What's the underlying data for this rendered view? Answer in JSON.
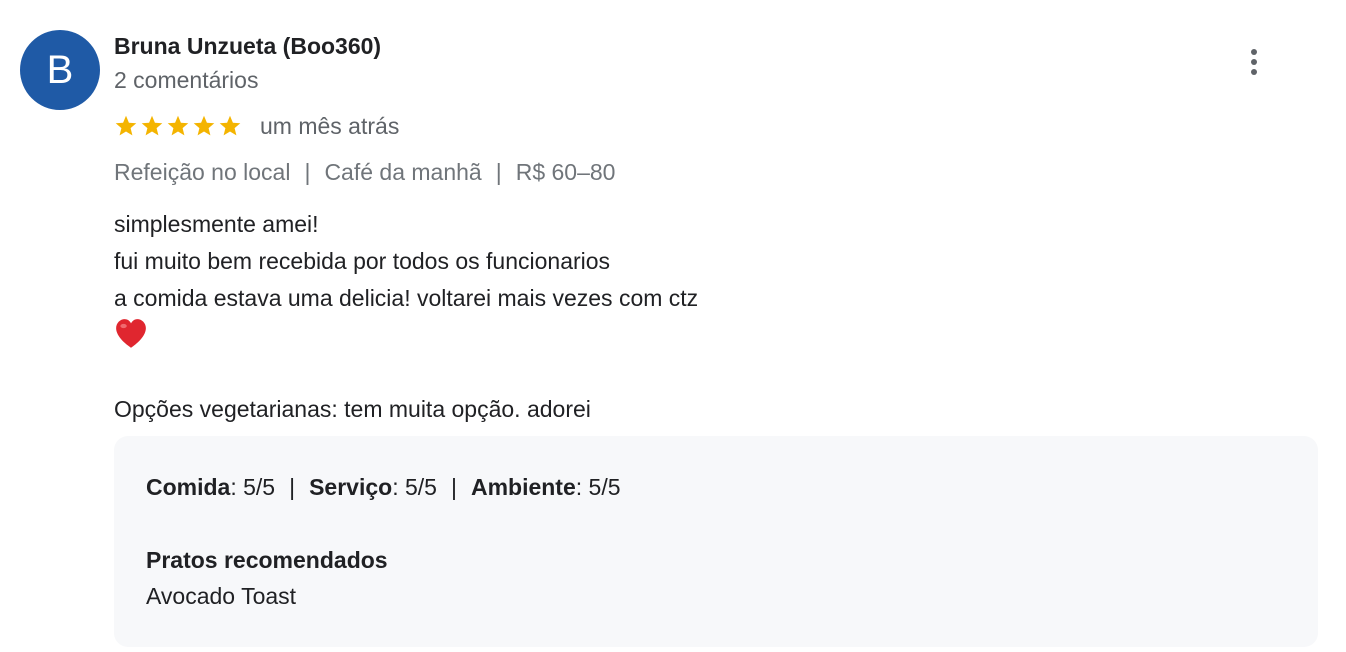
{
  "review": {
    "author": {
      "avatar_letter": "B",
      "avatar_color": "#1f5aa6",
      "name": "Bruna Unzueta (Boo360)",
      "meta": "2 comentários"
    },
    "more_icon": "more-vertical-icon",
    "rating": {
      "stars": 5,
      "max_stars": 5,
      "star_color": "#f4b400",
      "date": "um mês atrás"
    },
    "attributes": {
      "items": [
        "Refeição no local",
        "Café da manhã",
        "R$ 60–80"
      ],
      "separator": "|"
    },
    "text": {
      "lines": [
        "simplesmente amei!",
        "fui muito bem recebida por todos os funcionarios",
        "a comida estava uma delicia! voltarei mais vezes com ctz"
      ],
      "emoji": "red-heart-icon",
      "extra": "Opções vegetarianas: tem muita opção. adorei"
    },
    "details": {
      "scores": [
        {
          "label": "Comida",
          "value": ": 5/5"
        },
        {
          "label": "Serviço",
          "value": ": 5/5"
        },
        {
          "label": "Ambiente",
          "value": ": 5/5"
        }
      ],
      "separator": "|",
      "dishes_heading": "Pratos recomendados",
      "dishes": "Avocado Toast",
      "background": "#f7f8fa"
    }
  }
}
